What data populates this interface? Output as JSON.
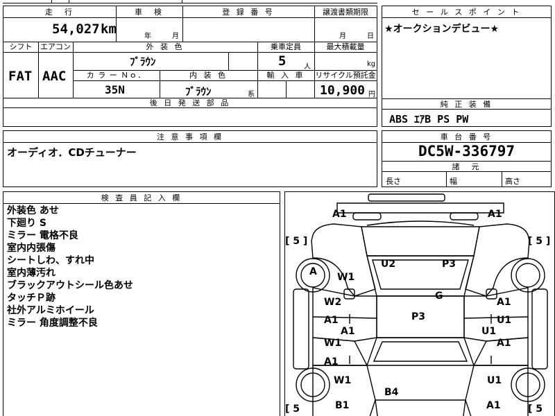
{
  "top_strip": {
    "partial_text": "出荷地"
  },
  "spec": {
    "mileage_header": "走　行",
    "mileage_value": "54,027",
    "mileage_unit": "km",
    "shaken_header": "車　検",
    "shaken_year_unit": "年",
    "shaken_month_unit": "月",
    "reg_header": "登 録 番 号",
    "transfer_header": "譲渡書類期限",
    "transfer_month_unit": "月",
    "transfer_day_unit": "日",
    "shift_header": "シフト",
    "aircon_header": "エアコン",
    "exterior_color_header": "外 装 色",
    "capacity_header": "乗車定員",
    "load_header": "最大積載量",
    "shift_value": "FAT",
    "aircon_value": "AAC",
    "exterior_color_value": "ﾌﾞﾗｳﾝ",
    "capacity_value": "5",
    "capacity_unit": "人",
    "load_unit": "kg",
    "color_no_header": "カ ラ ー Ｎｏ．",
    "interior_color_header": "内 装 色",
    "import_header": "輸 入 車",
    "recycle_header": "リサイクル預託金",
    "color_no_value": "35N",
    "interior_color_value": "ﾌﾞﾗｳﾝ",
    "interior_color_suffix": "系",
    "recycle_value": "10,900",
    "recycle_unit": "円",
    "later_parts_header": "後 日 発 送 部 品"
  },
  "sales_point": {
    "header": "セ ー ル ス ポ イ ン ト",
    "text": "★オークションデビュー★"
  },
  "genuine_equipment": {
    "header": "純 正 装 備",
    "text": "ABS ｴｱB PS PW"
  },
  "notes": {
    "header": "注 意 事 項 欄",
    "text": "オーディオ．CDチューナー"
  },
  "chassis": {
    "header": "車 台 番 号",
    "value": "DC5W-336797",
    "dims_header": "諸　元",
    "length_label": "長さ",
    "width_label": "幅",
    "height_label": "高さ"
  },
  "inspector": {
    "header": "検 査 員 記 入 欄",
    "items": [
      "外装色 あせ",
      "下廻り S",
      "ミラー 電格不良",
      "室内内張傷",
      "シートしわ、すれ中",
      "室内薄汚れ",
      "ブラックアウトシール色あせ",
      "タッチＰ跡",
      "社外アルミホイール",
      "ミラー 角度調整不良"
    ]
  },
  "diagram": {
    "tire_left_top": "[ 5 ]",
    "tire_right_top": "[ 5 ]",
    "tire_left_bottom": "[ 5",
    "tire_right_bottom": "[ 5",
    "marks": {
      "a1_top_left": "A1",
      "a1_top_right": "A1",
      "u2": "U2",
      "p3_top": "P3",
      "a_wheel": "A",
      "w1_front_left": "W1",
      "g": "G",
      "w2_left": "W2",
      "a1_left_1": "A1",
      "a1_center_left": "A1",
      "p3_center": "P3",
      "a1_right_1": "A1",
      "u1_right_1": "U1",
      "u1_center_right": "U1",
      "w1_left_2": "W1",
      "a1_left_2": "A1",
      "a1_right_2": "A1",
      "w1_rear_left": "W1",
      "u1_rear_right": "U1",
      "b4": "B4",
      "b1": "B1",
      "a1_bottom_right": "A1"
    }
  }
}
